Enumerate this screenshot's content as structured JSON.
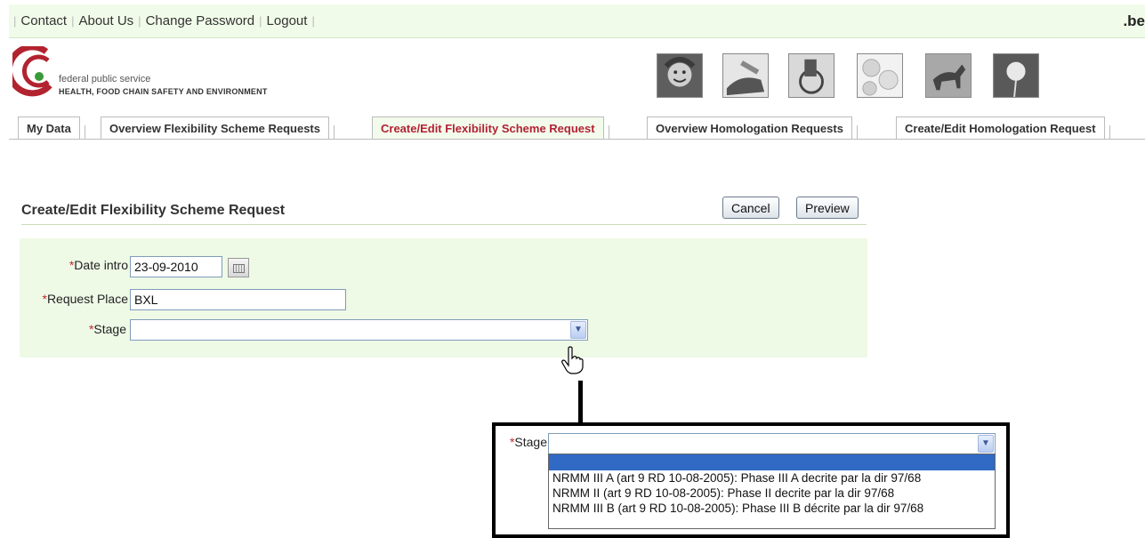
{
  "topnav": {
    "links": [
      "Contact",
      "About Us",
      "Change Password",
      "Logout"
    ],
    "country_domain": ".be"
  },
  "logo": {
    "line1": "federal public service",
    "line2": "HEALTH, FOOD CHAIN SAFETY AND ENVIRONMENT"
  },
  "tabs": [
    {
      "label": "My Data",
      "active": false
    },
    {
      "label": "Overview Flexibility Scheme Requests",
      "active": false
    },
    {
      "label": "Create/Edit  Flexibility Scheme Request",
      "active": true
    },
    {
      "label": "Overview  Homologation Requests",
      "active": false
    },
    {
      "label": "Create/Edit  Homologation Request",
      "active": false
    }
  ],
  "page": {
    "title": "Create/Edit Flexibility Scheme Request",
    "cancel_label": "Cancel",
    "preview_label": "Preview"
  },
  "form": {
    "date_intro": {
      "label": "Date intro",
      "value": "23-09-2010"
    },
    "request_place": {
      "label": "Request Place",
      "value": "BXL"
    },
    "stage": {
      "label": "Stage",
      "value": ""
    },
    "required_marker": "*"
  },
  "zoom_callout": {
    "stage_label": "Stage",
    "stage_value": "",
    "options": [
      "",
      "NRMM III A (art 9 RD 10-08-2005): Phase III A decrite par la dir 97/68",
      "NRMM II (art 9 RD 10-08-2005): Phase II decrite par la dir 97/68",
      "NRMM III B (art 9 RD 10-08-2005): Phase III B décrite par la dir 97/68"
    ],
    "highlighted_index": 0
  },
  "colors": {
    "accent_green_bg": "#eef9e6",
    "active_tab_text": "#b22234",
    "required_marker": "#c0282c",
    "selection_blue": "#316ac5"
  }
}
